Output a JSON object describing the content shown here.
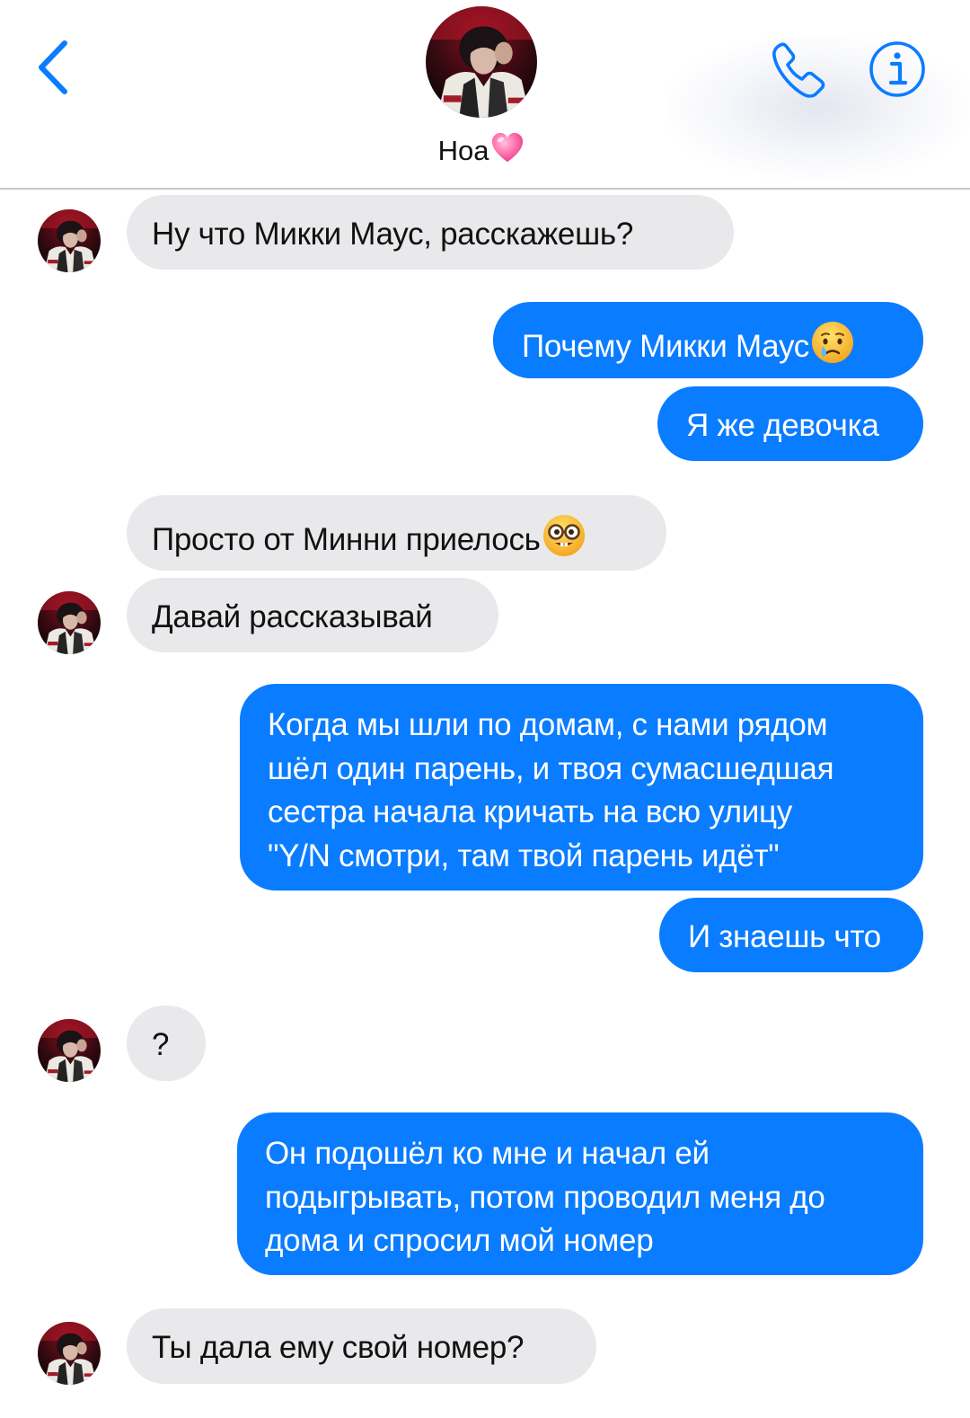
{
  "header": {
    "contact_name": "Ноа",
    "name_emoji": "pink-heart-emoji",
    "back_icon": "chevron-left-icon",
    "call_icon": "phone-icon",
    "info_icon": "info-icon",
    "accent_color": "#0a7cff"
  },
  "messages": [
    {
      "direction": "incoming",
      "text": "Ну что Микки Маус, расскажешь?",
      "show_avatar": true
    },
    {
      "direction": "outgoing",
      "text": "Почему Микки Маус",
      "emoji": "crying-face-emoji"
    },
    {
      "direction": "outgoing",
      "text": "Я же девочка"
    },
    {
      "direction": "incoming",
      "text": "Просто от Минни приелось",
      "emoji": "nerd-face-emoji"
    },
    {
      "direction": "incoming",
      "text": "Давай рассказывай",
      "show_avatar": true
    },
    {
      "direction": "outgoing",
      "lines": [
        "Когда мы шли по домам, с нами рядом",
        "шёл один парень, и твоя сумасшедшая",
        "сестра начала кричать на всю улицу",
        "\"Y/N смотри, там твой парень идёт\""
      ]
    },
    {
      "direction": "outgoing",
      "text": "И знаешь что"
    },
    {
      "direction": "incoming",
      "text": "?",
      "show_avatar": true
    },
    {
      "direction": "outgoing",
      "lines": [
        "Он подошёл ко мне и начал ей",
        "подыгрывать, потом проводил меня до",
        "дома и спросил мой номер"
      ]
    },
    {
      "direction": "incoming",
      "text": "Ты дала ему свой номер?",
      "show_avatar": true
    }
  ],
  "colors": {
    "incoming_bubble": "#e9e9eb",
    "outgoing_bubble": "#0a7cff",
    "incoming_text": "#111111",
    "outgoing_text": "#ffffff"
  }
}
